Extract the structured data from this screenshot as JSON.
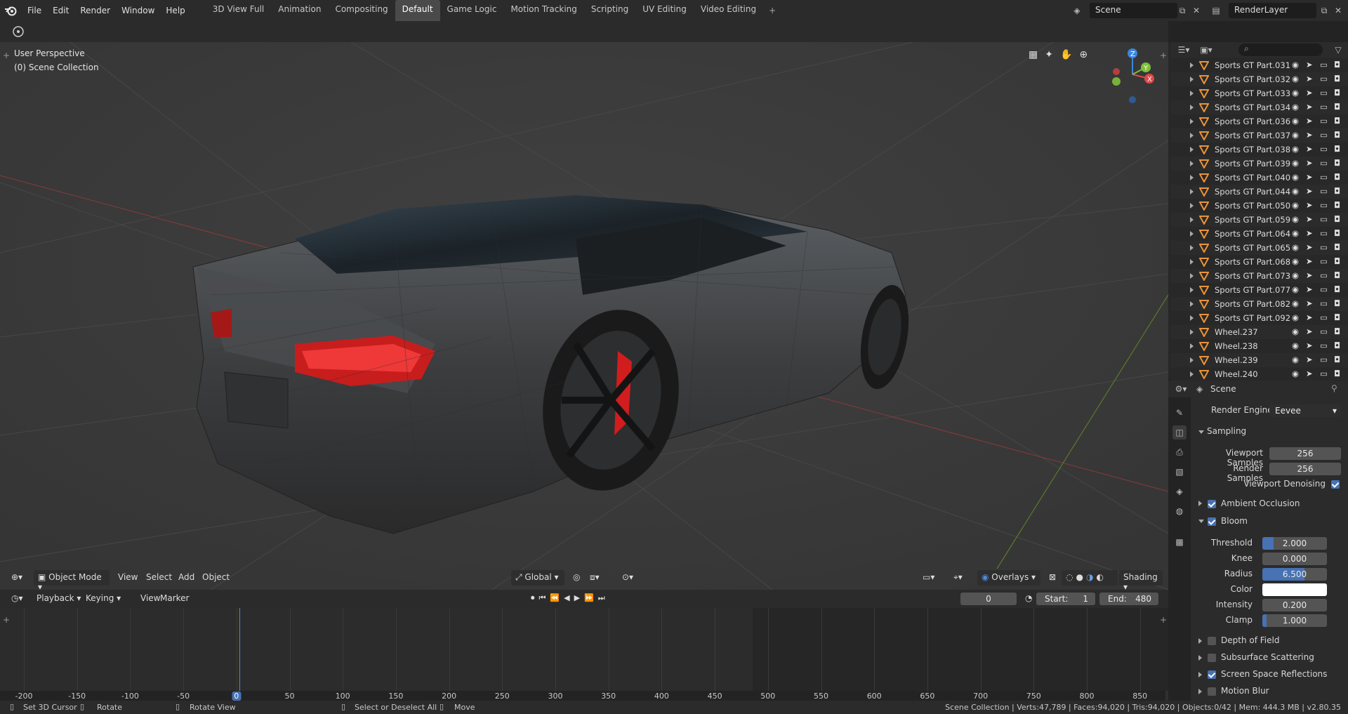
{
  "menu": [
    "File",
    "Edit",
    "Render",
    "Window",
    "Help"
  ],
  "workspaces": [
    "3D View Full",
    "Animation",
    "Compositing",
    "Default",
    "Game Logic",
    "Motion Tracking",
    "Scripting",
    "UV Editing",
    "Video Editing"
  ],
  "active_workspace": "Default",
  "scene_name": "Scene",
  "view_layer": "RenderLayer",
  "viewport": {
    "perspective": "User Perspective",
    "collection": "(0) Scene Collection",
    "axes": {
      "z": "Z",
      "x": "X",
      "y": "Y"
    }
  },
  "viewport_header": {
    "mode": "Object Mode",
    "view": "View",
    "select": "Select",
    "add": "Add",
    "object": "Object",
    "orientation": "Global",
    "overlays": "Overlays",
    "shading": "Shading"
  },
  "timeline": {
    "playback": "Playback",
    "keying": "Keying",
    "view": "View",
    "marker": "Marker",
    "current_frame": "0",
    "start_label": "Start:",
    "start": "1",
    "end_label": "End:",
    "end": "480",
    "ticks": [
      "-200",
      "-150",
      "-100",
      "-50",
      "0",
      "50",
      "100",
      "150",
      "200",
      "250",
      "300",
      "350",
      "400",
      "450",
      "500",
      "550",
      "600",
      "650",
      "700",
      "750",
      "800",
      "850"
    ]
  },
  "outliner": {
    "items": [
      {
        "name": "Sports GT Part.031",
        "type": "mesh"
      },
      {
        "name": "Sports GT Part.032",
        "type": "mesh"
      },
      {
        "name": "Sports GT Part.033",
        "type": "mesh"
      },
      {
        "name": "Sports GT Part.034",
        "type": "mesh"
      },
      {
        "name": "Sports GT Part.036",
        "type": "mesh"
      },
      {
        "name": "Sports GT Part.037",
        "type": "mesh"
      },
      {
        "name": "Sports GT Part.038",
        "type": "mesh"
      },
      {
        "name": "Sports GT Part.039",
        "type": "mesh"
      },
      {
        "name": "Sports GT Part.040",
        "type": "mesh"
      },
      {
        "name": "Sports GT Part.044",
        "type": "mesh"
      },
      {
        "name": "Sports GT Part.050",
        "type": "mesh"
      },
      {
        "name": "Sports GT Part.059",
        "type": "mesh"
      },
      {
        "name": "Sports GT Part.064",
        "type": "mesh"
      },
      {
        "name": "Sports GT Part.065",
        "type": "mesh"
      },
      {
        "name": "Sports GT Part.068",
        "type": "mesh"
      },
      {
        "name": "Sports GT Part.073",
        "type": "mesh"
      },
      {
        "name": "Sports GT Part.077",
        "type": "mesh"
      },
      {
        "name": "Sports GT Part.082",
        "type": "mesh"
      },
      {
        "name": "Sports GT Part.092",
        "type": "mesh"
      },
      {
        "name": "Wheel.237",
        "type": "mesh"
      },
      {
        "name": "Wheel.238",
        "type": "mesh"
      },
      {
        "name": "Wheel.239",
        "type": "mesh"
      },
      {
        "name": "Wheel.240",
        "type": "mesh"
      }
    ]
  },
  "properties": {
    "context": "Scene",
    "render_engine_label": "Render Engine",
    "render_engine": "Eevee",
    "sampling": {
      "title": "Sampling",
      "viewport_samples_label": "Viewport Samples",
      "viewport_samples": "256",
      "render_samples_label": "Render Samples",
      "render_samples": "256",
      "viewport_denoising_label": "Viewport Denoising"
    },
    "ambient_occlusion": "Ambient Occlusion",
    "bloom": {
      "title": "Bloom",
      "threshold_label": "Threshold",
      "threshold": "2.000",
      "knee_label": "Knee",
      "knee": "0.000",
      "radius_label": "Radius",
      "radius": "6.500",
      "color_label": "Color",
      "intensity_label": "Intensity",
      "intensity": "0.200",
      "clamp_label": "Clamp",
      "clamp": "1.000"
    },
    "depth_of_field": "Depth of Field",
    "subsurface_scattering": "Subsurface Scattering",
    "screen_space_reflections": "Screen Space Reflections",
    "motion_blur": "Motion Blur"
  },
  "status": {
    "cursor": "Set 3D Cursor",
    "rotate": "Rotate",
    "rotate_view": "Rotate View",
    "select": "Select or Deselect All",
    "move": "Move",
    "stats": "Scene Collection | Verts:47,789 | Faces:94,020 | Tris:94,020 | Objects:0/42 | Mem: 444.3 MB | v2.80.35"
  },
  "colors": {
    "accent": "#4772b3",
    "mesh_icon": "#e8933a",
    "x_axis": "#e04848",
    "y_axis": "#7fbf3a",
    "z_axis": "#3b86e0"
  }
}
